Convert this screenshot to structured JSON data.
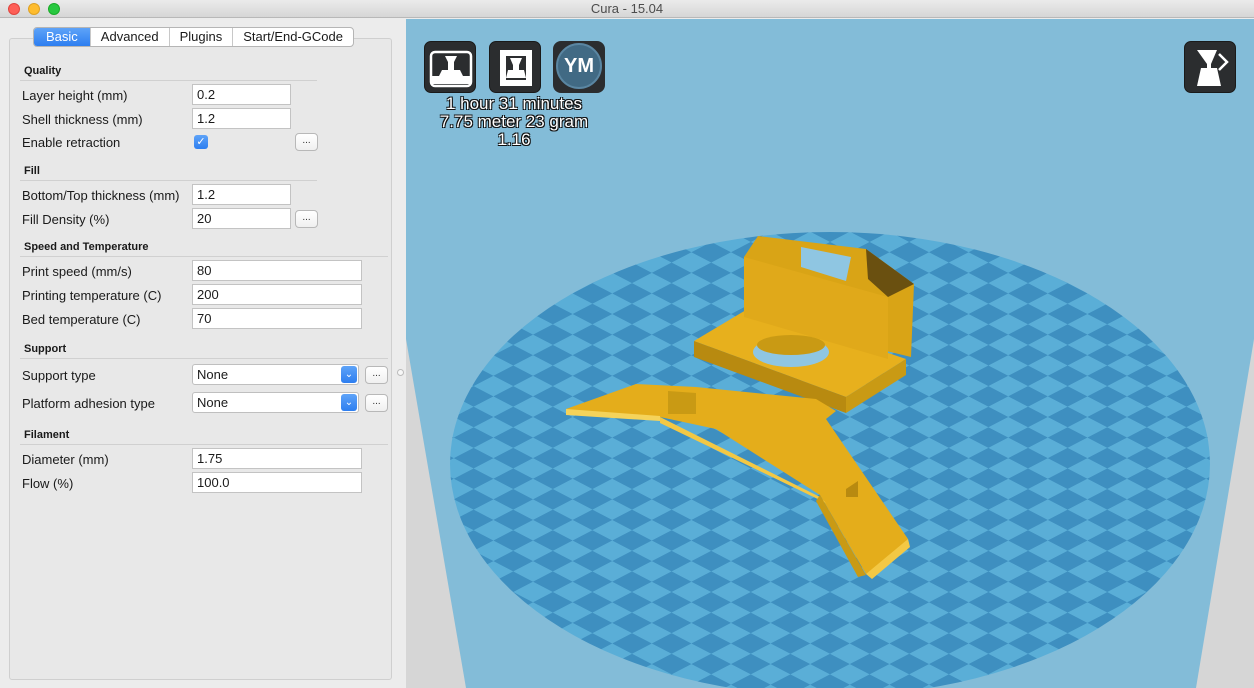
{
  "window": {
    "title": "Cura - 15.04"
  },
  "tabs": [
    {
      "label": "Basic",
      "active": true
    },
    {
      "label": "Advanced",
      "active": false
    },
    {
      "label": "Plugins",
      "active": false
    },
    {
      "label": "Start/End-GCode",
      "active": false
    }
  ],
  "quality": {
    "heading": "Quality",
    "layer_height_label": "Layer height (mm)",
    "layer_height_value": "0.2",
    "shell_thickness_label": "Shell thickness (mm)",
    "shell_thickness_value": "1.2",
    "retraction_label": "Enable retraction",
    "retraction_checked": true,
    "checkmark": "✓"
  },
  "fill": {
    "heading": "Fill",
    "bottom_top_label": "Bottom/Top thickness (mm)",
    "bottom_top_value": "1.2",
    "density_label": "Fill Density (%)",
    "density_value": "20"
  },
  "speed": {
    "heading": "Speed and Temperature",
    "print_speed_label": "Print speed (mm/s)",
    "print_speed_value": "80",
    "print_temp_label": "Printing temperature (C)",
    "print_temp_value": "200",
    "bed_temp_label": "Bed temperature (C)",
    "bed_temp_value": "70"
  },
  "support": {
    "heading": "Support",
    "type_label": "Support type",
    "type_value": "None",
    "adhesion_label": "Platform adhesion type",
    "adhesion_value": "None"
  },
  "filament": {
    "heading": "Filament",
    "diameter_label": "Diameter (mm)",
    "diameter_value": "1.75",
    "flow_label": "Flow (%)",
    "flow_value": "100.0"
  },
  "buttons": {
    "more": "..."
  },
  "viewport": {
    "load_icon": "load-model-icon",
    "sd_icon": "save-toolpath-icon",
    "ym_label": "YM",
    "view_mode_icon": "view-mode-icon",
    "print_time": "1 hour 31 minutes",
    "material": "7.75 meter 23 gram",
    "cost": "1.16",
    "colors": {
      "background": "#83bcd8",
      "model": "#e8b21c",
      "bed_light": "#5aaed7",
      "bed_dark": "#3e8fc0"
    }
  }
}
